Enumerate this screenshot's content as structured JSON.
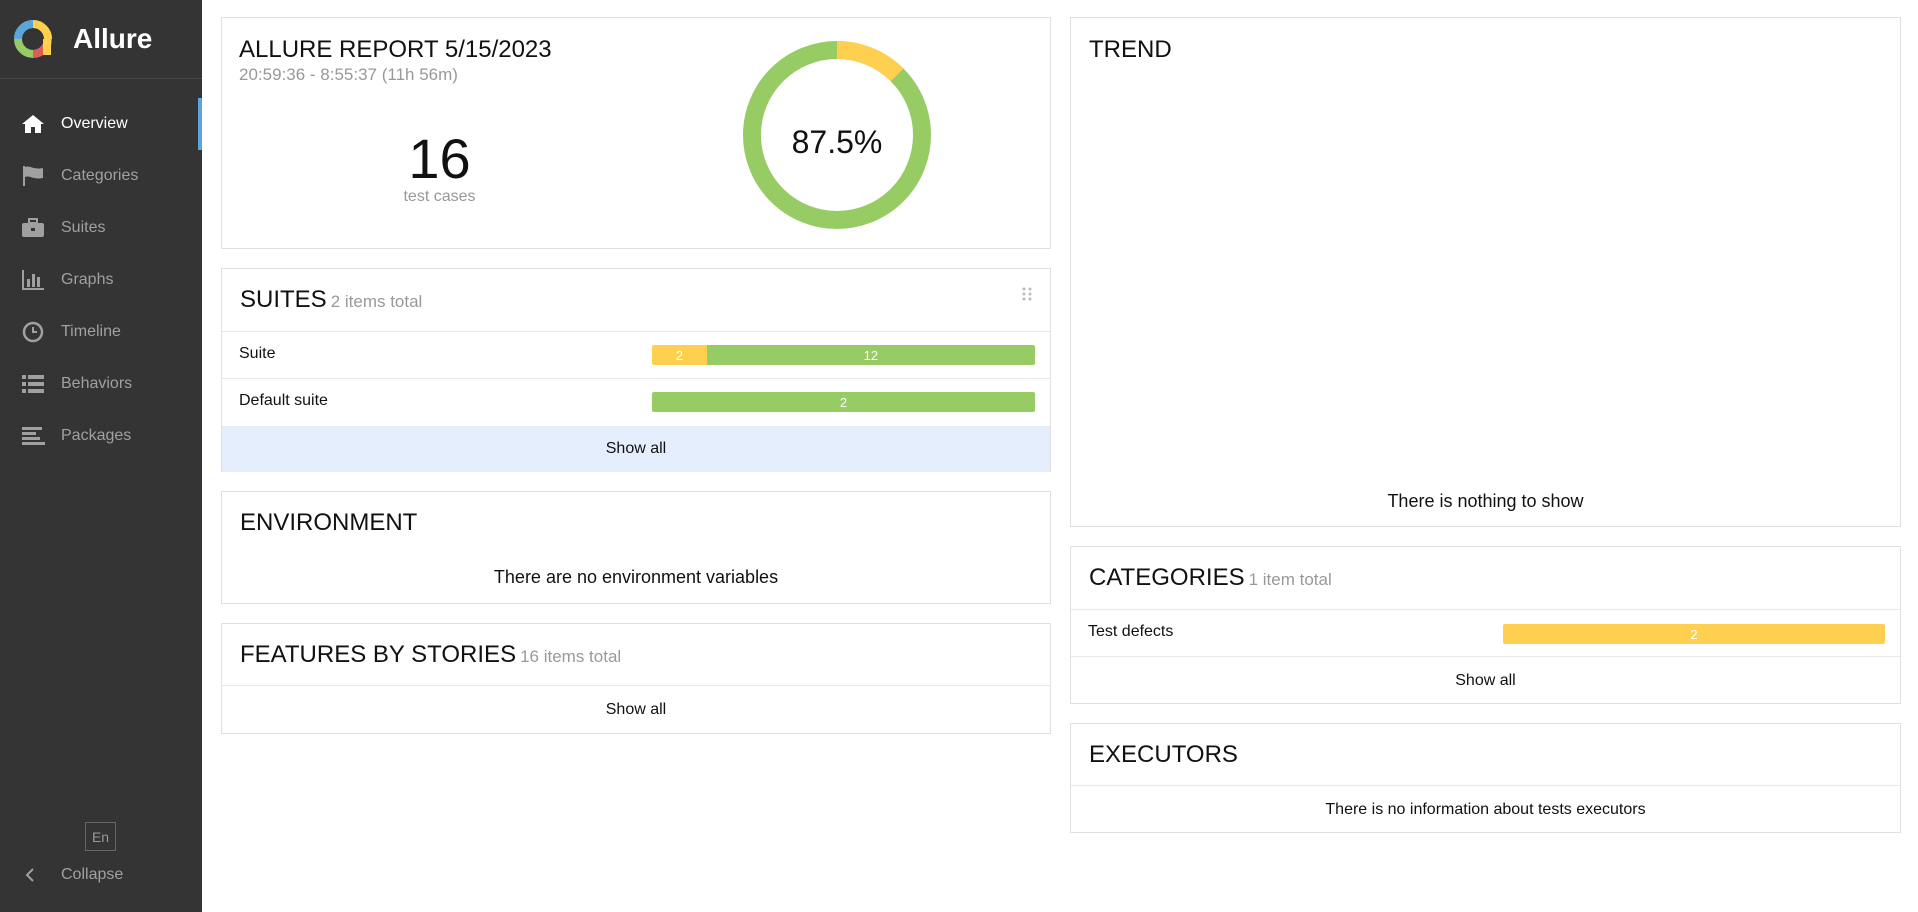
{
  "app": {
    "name": "Allure",
    "logo_colors": [
      "#ffd050",
      "#97cc64",
      "#5aa5de",
      "#e05a5a",
      "#9b6fd0"
    ]
  },
  "sidebar": {
    "items": [
      {
        "label": "Overview",
        "icon": "home-icon",
        "active": true
      },
      {
        "label": "Categories",
        "icon": "flag-icon",
        "active": false
      },
      {
        "label": "Suites",
        "icon": "briefcase-icon",
        "active": false
      },
      {
        "label": "Graphs",
        "icon": "bar-chart-icon",
        "active": false
      },
      {
        "label": "Timeline",
        "icon": "clock-icon",
        "active": false
      },
      {
        "label": "Behaviors",
        "icon": "list-icon",
        "active": false
      },
      {
        "label": "Packages",
        "icon": "align-left-icon",
        "active": false
      }
    ],
    "language": "En",
    "collapse_label": "Collapse"
  },
  "summary": {
    "title": "ALLURE REPORT 5/15/2023",
    "time_range": "20:59:36 - 8:55:37 (11h 56m)",
    "test_count": "16",
    "test_count_label": "test cases",
    "pass_rate": "87.5%",
    "donut": {
      "passed": 14,
      "broken": 2,
      "passed_color": "#97cc64",
      "broken_color": "#ffd050"
    }
  },
  "suites": {
    "title": "SUITES",
    "subtitle": "2 items total",
    "rows": [
      {
        "name": "Suite",
        "broken": "2",
        "passed": "12",
        "broken_value": 2,
        "passed_value": 12
      },
      {
        "name": "Default suite",
        "passed": "2",
        "passed_value": 2
      }
    ],
    "show_all": "Show all"
  },
  "environment": {
    "title": "ENVIRONMENT",
    "empty": "There are no environment variables"
  },
  "features": {
    "title": "FEATURES BY STORIES",
    "subtitle": "16 items total",
    "show_all": "Show all"
  },
  "trend": {
    "title": "TREND",
    "empty": "There is nothing to show"
  },
  "categories": {
    "title": "CATEGORIES",
    "subtitle": "1 item total",
    "rows": [
      {
        "name": "Test defects",
        "count": "2"
      }
    ],
    "show_all": "Show all"
  },
  "executors": {
    "title": "EXECUTORS",
    "empty": "There is no information about tests executors"
  }
}
